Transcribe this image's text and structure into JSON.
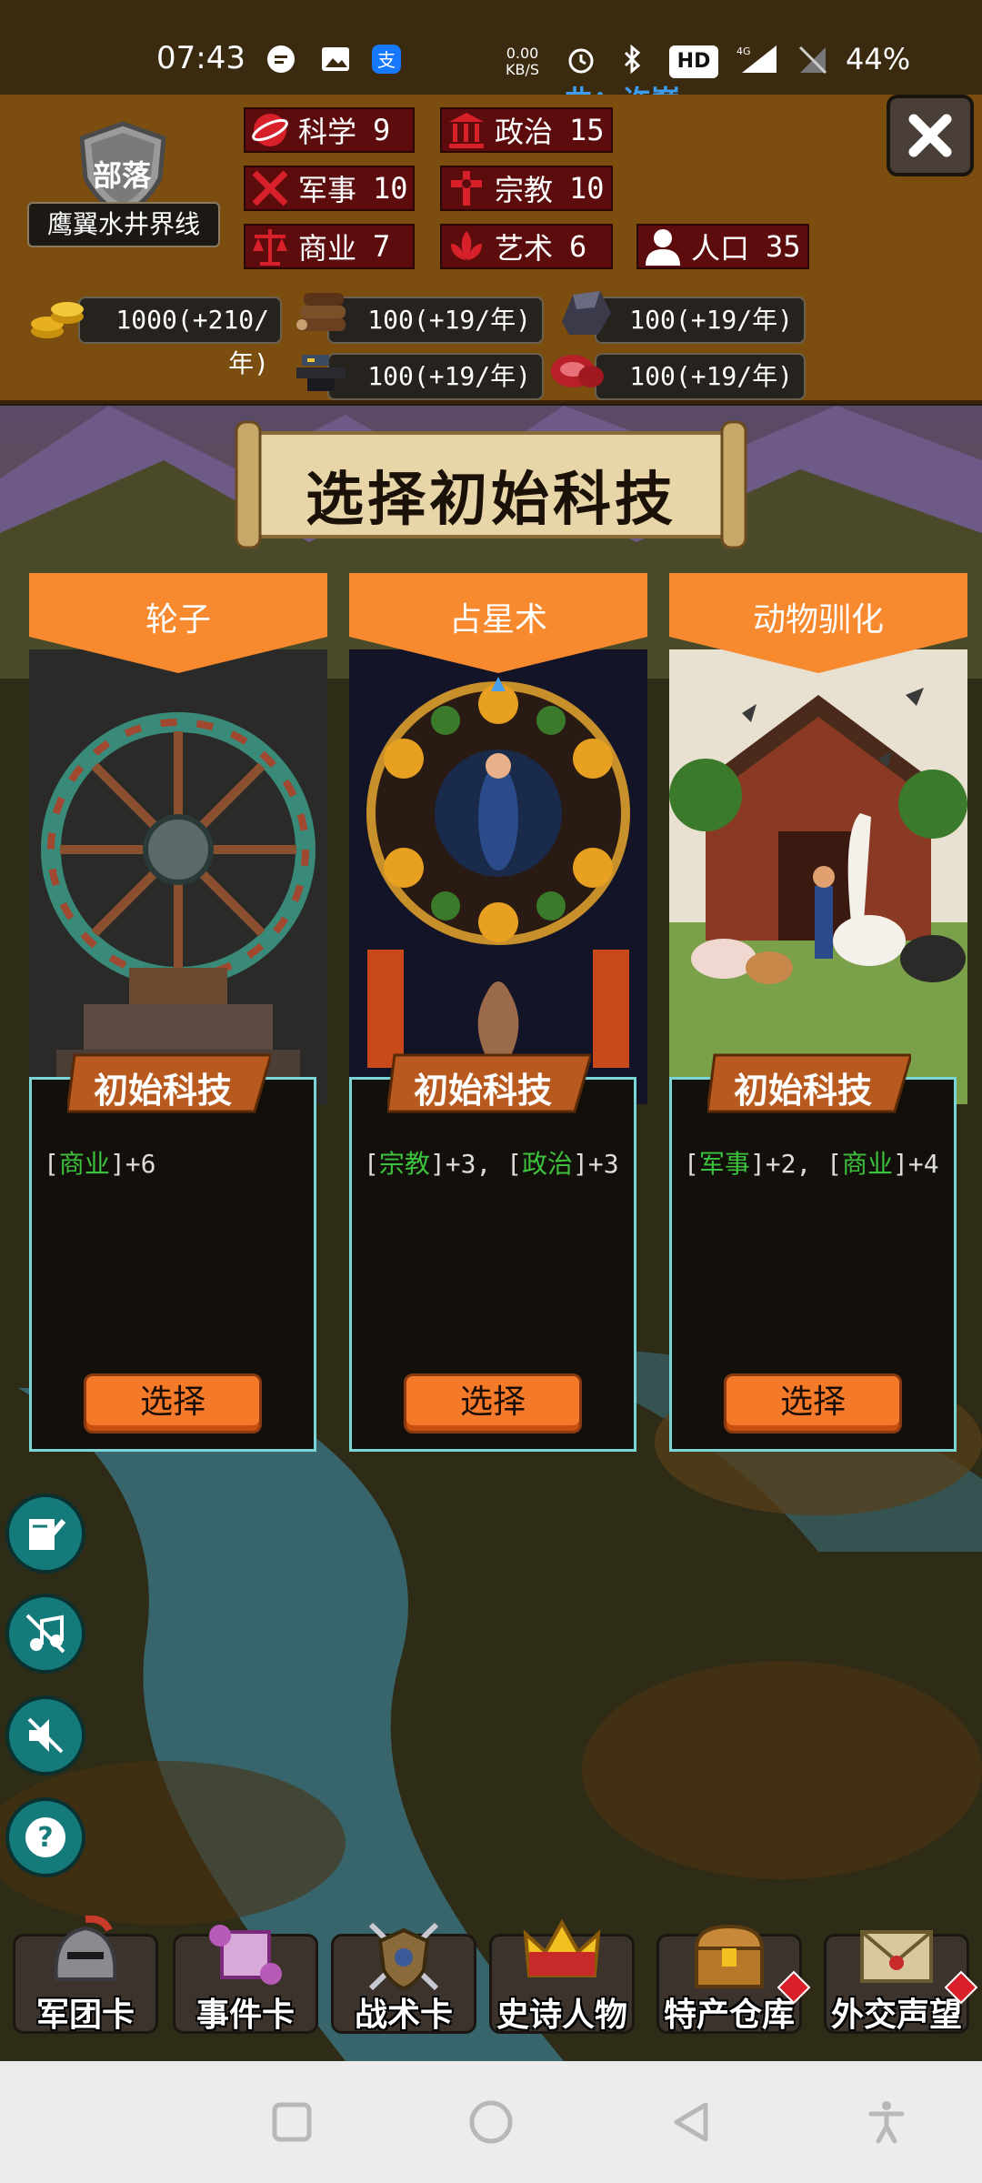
{
  "status_bar": {
    "time": "07:43",
    "net_speed_value": "0.00",
    "net_speed_unit": "KB/S",
    "hd_badge": "HD",
    "network": "4G",
    "battery": "44%"
  },
  "lyric": "曲：许巍",
  "tribe": {
    "rank": "部落",
    "name": "鹰翼水井界线"
  },
  "stats": [
    {
      "label": "科学",
      "value": "9",
      "icon": "science-icon"
    },
    {
      "label": "政治",
      "value": "15",
      "icon": "politics-icon"
    },
    {
      "label": "军事",
      "value": "10",
      "icon": "military-icon"
    },
    {
      "label": "宗教",
      "value": "10",
      "icon": "religion-icon"
    },
    {
      "label": "商业",
      "value": "7",
      "icon": "commerce-icon"
    },
    {
      "label": "艺术",
      "value": "6",
      "icon": "art-icon"
    },
    {
      "label": "人口",
      "value": "35",
      "icon": "population-icon"
    }
  ],
  "resources": [
    {
      "value": "1000(+210/年)",
      "icon": "gold-coins-icon"
    },
    {
      "value": "100(+19/年)",
      "icon": "wood-logs-icon"
    },
    {
      "value": "100(+19/年)",
      "icon": "stone-ore-icon"
    },
    {
      "value": "100(+19/年)",
      "icon": "iron-anvil-icon"
    },
    {
      "value": "100(+19/年)",
      "icon": "meat-icon"
    }
  ],
  "page_title": "选择初始科技",
  "cards": [
    {
      "name": "轮子",
      "tag": "初始科技",
      "effects": [
        {
          "attr": "商业",
          "bonus": "+6"
        }
      ],
      "button": "选择"
    },
    {
      "name": "占星术",
      "tag": "初始科技",
      "effects": [
        {
          "attr": "宗教",
          "bonus": "+3"
        },
        {
          "attr": "政治",
          "bonus": "+3"
        }
      ],
      "button": "选择"
    },
    {
      "name": "动物驯化",
      "tag": "初始科技",
      "effects": [
        {
          "attr": "军事",
          "bonus": "+2"
        },
        {
          "attr": "商业",
          "bonus": "+4"
        }
      ],
      "button": "选择"
    }
  ],
  "bottom_menu": [
    {
      "label": "军团卡",
      "icon": "helmet-icon",
      "badge": false
    },
    {
      "label": "事件卡",
      "icon": "scroll-icon",
      "badge": false
    },
    {
      "label": "战术卡",
      "icon": "shield-swords-icon",
      "badge": false
    },
    {
      "label": "史诗人物",
      "icon": "crown-icon",
      "badge": false
    },
    {
      "label": "特产仓库",
      "icon": "treasure-chest-icon",
      "badge": true
    },
    {
      "label": "外交声望",
      "icon": "envelope-icon",
      "badge": true
    }
  ],
  "colors": {
    "header_bg": "#7b4e10",
    "stat_bg": "#5c0c0c",
    "card_header": "#f7892e",
    "card_border": "#7ad6d6",
    "effect_attr": "#3cc23c",
    "select_button": "#f47a2a",
    "side_button": "#157a7a"
  }
}
